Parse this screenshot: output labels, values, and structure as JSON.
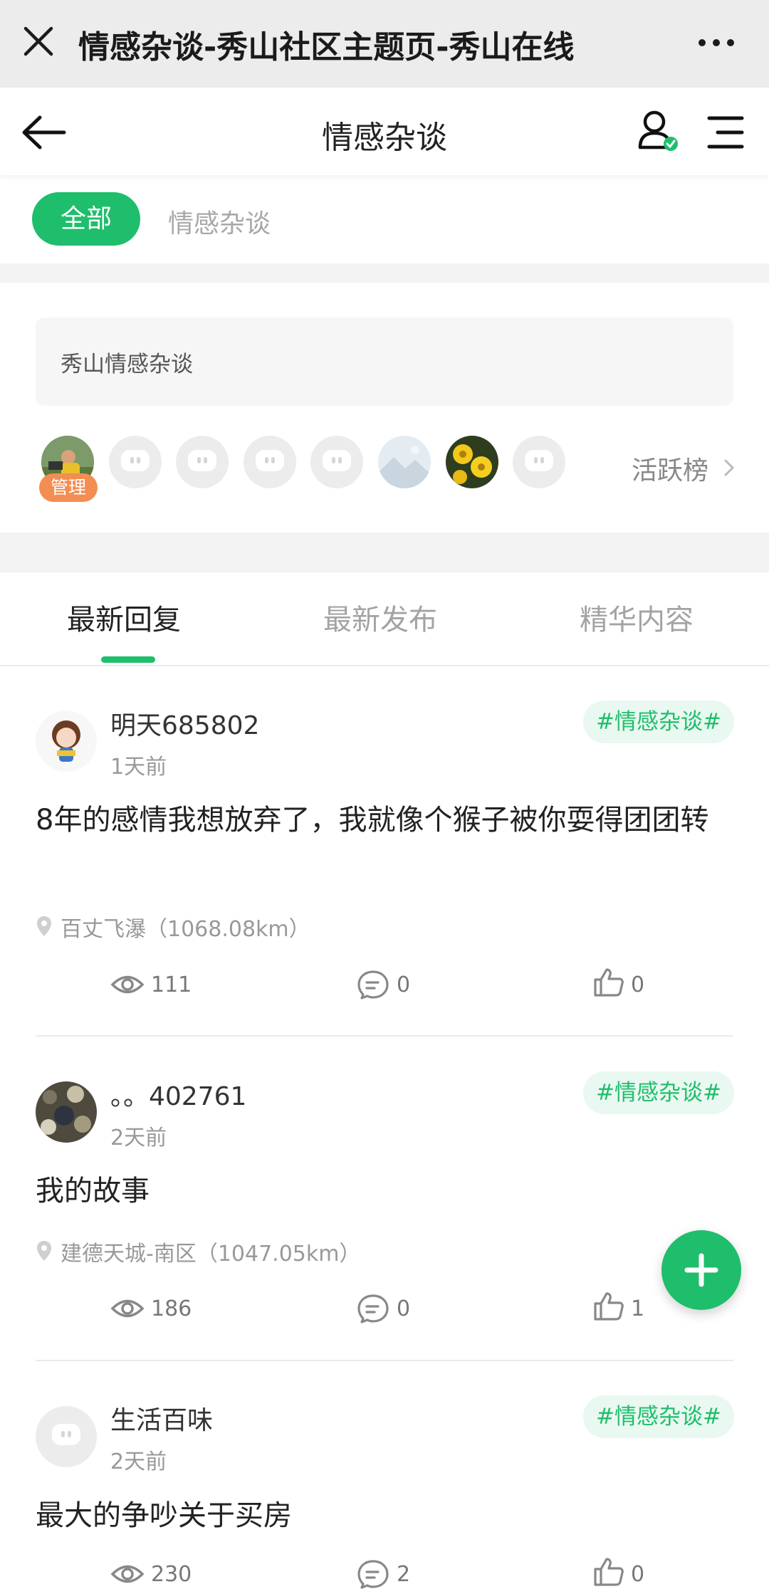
{
  "browser": {
    "title": "情感杂谈-秀山社区主题页-秀山在线"
  },
  "header": {
    "title": "情感杂谈"
  },
  "chips": {
    "all": "全部",
    "category": "情感杂谈"
  },
  "intro": {
    "text": "秀山情感杂谈"
  },
  "members": {
    "admin_badge": "管理",
    "rank_link": "活跃榜"
  },
  "tabs": [
    {
      "label": "最新回复",
      "active": true
    },
    {
      "label": "最新发布",
      "active": false
    },
    {
      "label": "精华内容",
      "active": false
    }
  ],
  "posts": [
    {
      "author": "明天685802",
      "time": "1天前",
      "tag": "#情感杂谈#",
      "title": "8年的感情我想放弃了，我就像个猴子被你耍得团团转",
      "location": "百丈飞瀑（1068.08km）",
      "views": "111",
      "comments": "0",
      "likes": "0"
    },
    {
      "author": "。。402761",
      "time": "2天前",
      "tag": "#情感杂谈#",
      "title": "我的故事",
      "location": "建德天城-南区（1047.05km）",
      "views": "186",
      "comments": "0",
      "likes": "1"
    },
    {
      "author": "生活百味",
      "time": "2天前",
      "tag": "#情感杂谈#",
      "title": "最大的争吵关于买房",
      "views": "230",
      "comments": "2",
      "likes": "0"
    }
  ],
  "colors": {
    "accent": "#1fbe6c",
    "admin_badge": "#f28e52",
    "tag_bg": "#e9f8f0"
  }
}
